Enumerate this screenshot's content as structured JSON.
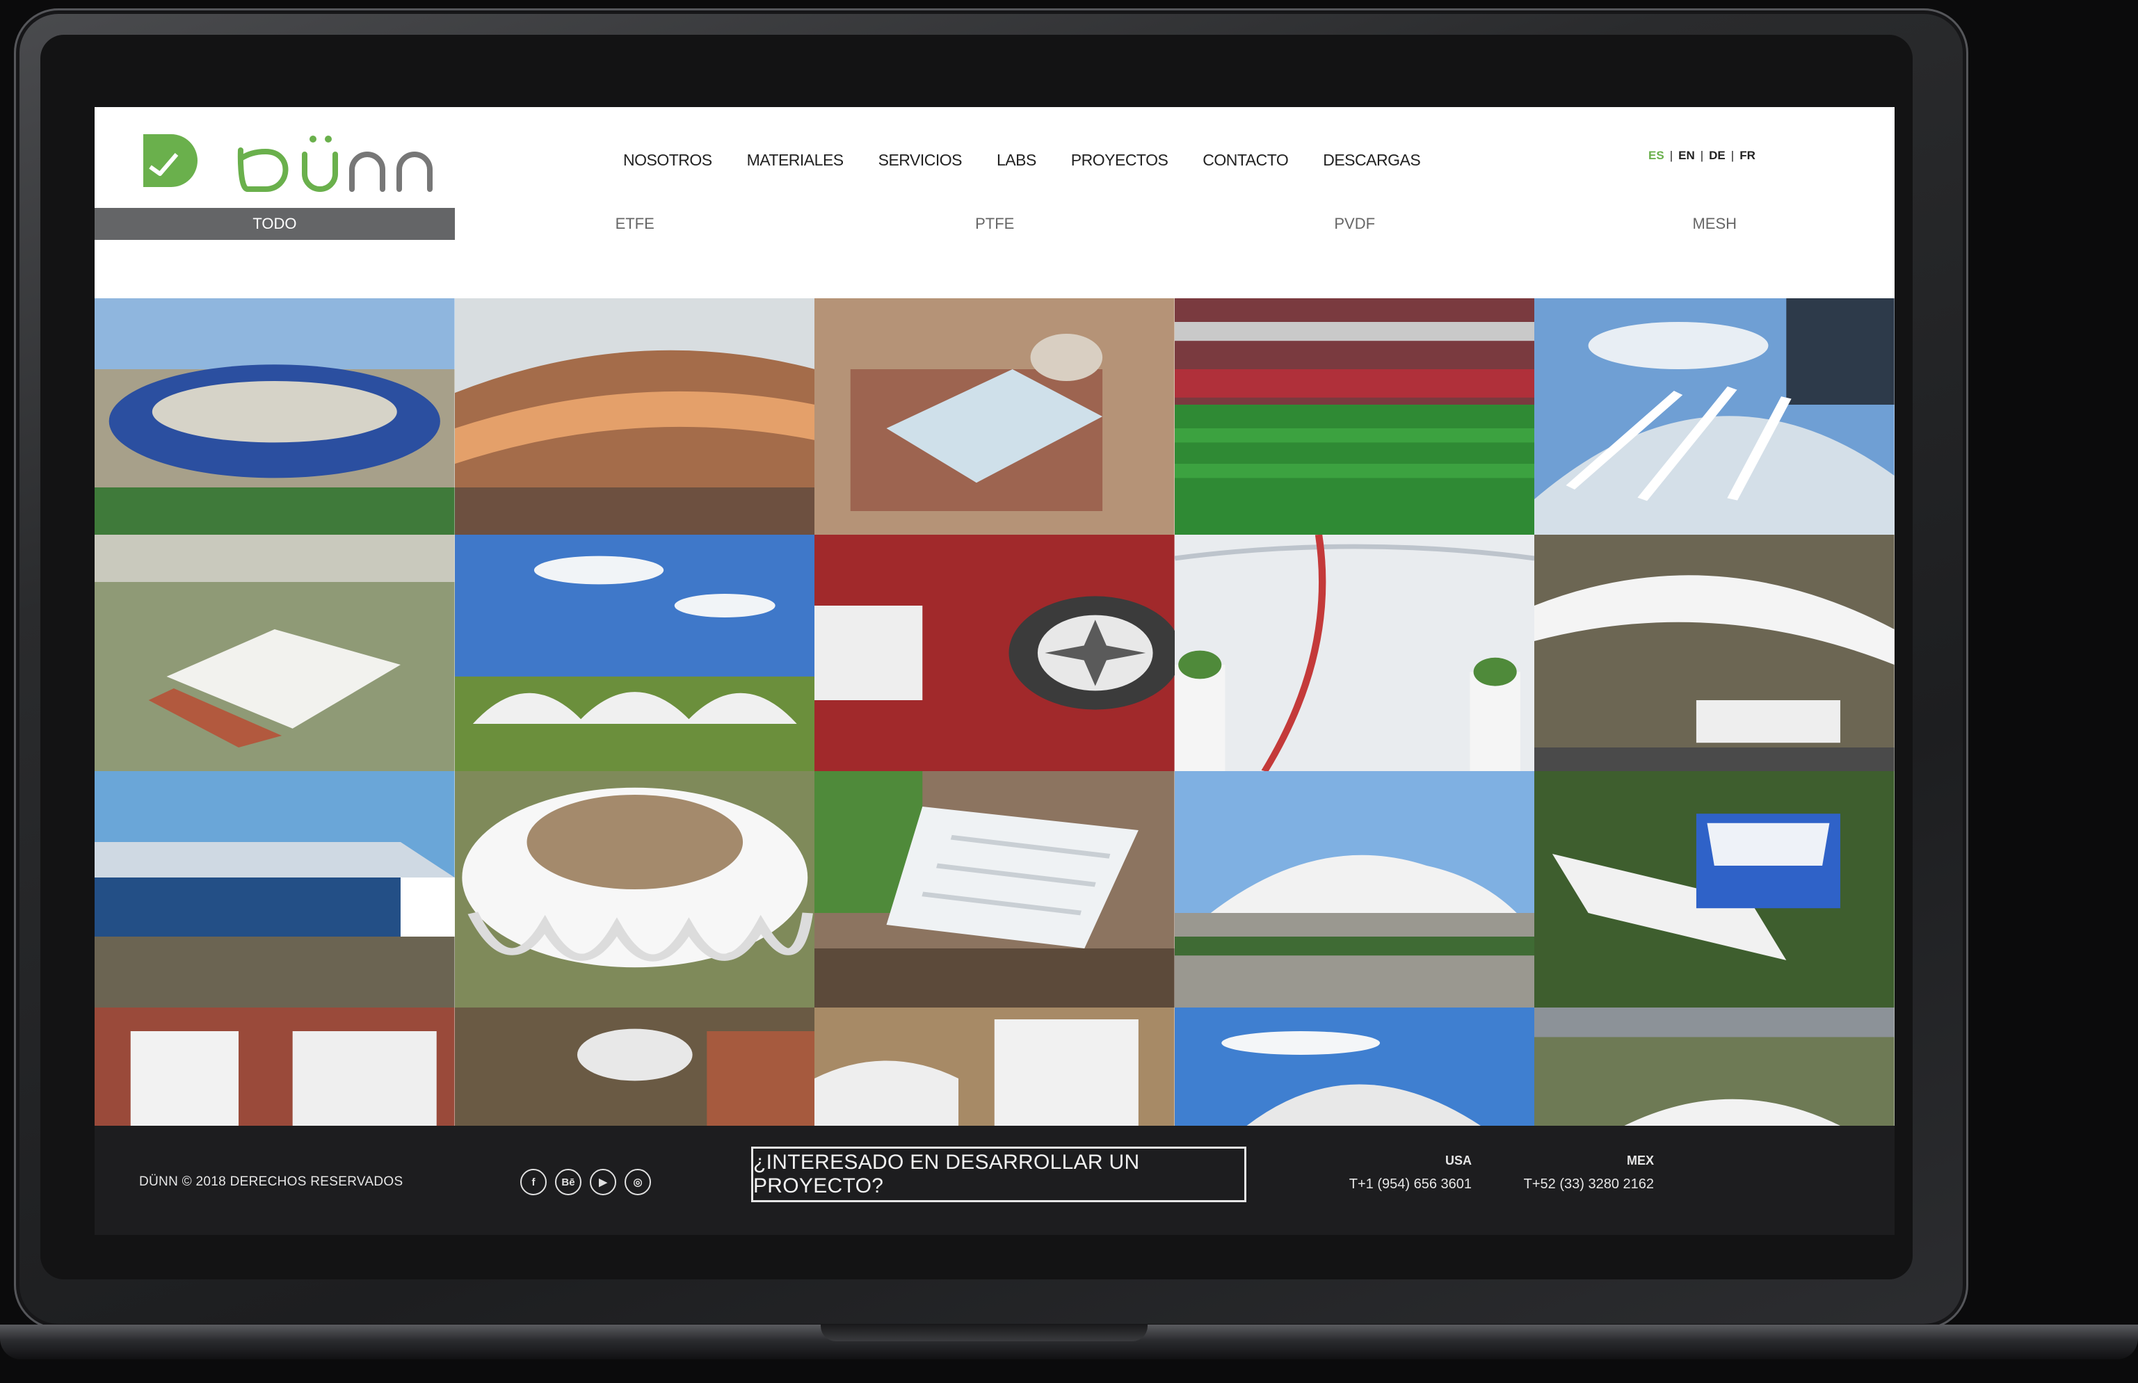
{
  "brand": {
    "name": "DÜNN",
    "accent": "#6ab04c"
  },
  "nav": {
    "items": [
      "NOSOTROS",
      "MATERIALES",
      "SERVICIOS",
      "LABS",
      "PROYECTOS",
      "CONTACTO",
      "DESCARGAS"
    ]
  },
  "languages": {
    "active": "ES",
    "others": [
      "EN",
      "DE",
      "FR"
    ],
    "separator": "|"
  },
  "filters": {
    "items": [
      "TODO",
      "ETFE",
      "PTFE",
      "PVDF",
      "MESH"
    ],
    "active_index": 0
  },
  "footer": {
    "copyright": "DÜNN © 2018 DERECHOS RESERVADOS",
    "social": [
      "facebook-icon",
      "behance-icon",
      "youtube-icon",
      "instagram-icon"
    ],
    "social_glyphs": [
      "f",
      "Bē",
      "▶",
      "◎"
    ],
    "cta": "¿INTERESADO EN DESARROLLAR UN PROYECTO?",
    "usa_label": "USA",
    "usa_phone": "T+1 (954) 656 3601",
    "mex_label": "MEX",
    "mex_phone": "T+52 (33) 3280 2162"
  }
}
